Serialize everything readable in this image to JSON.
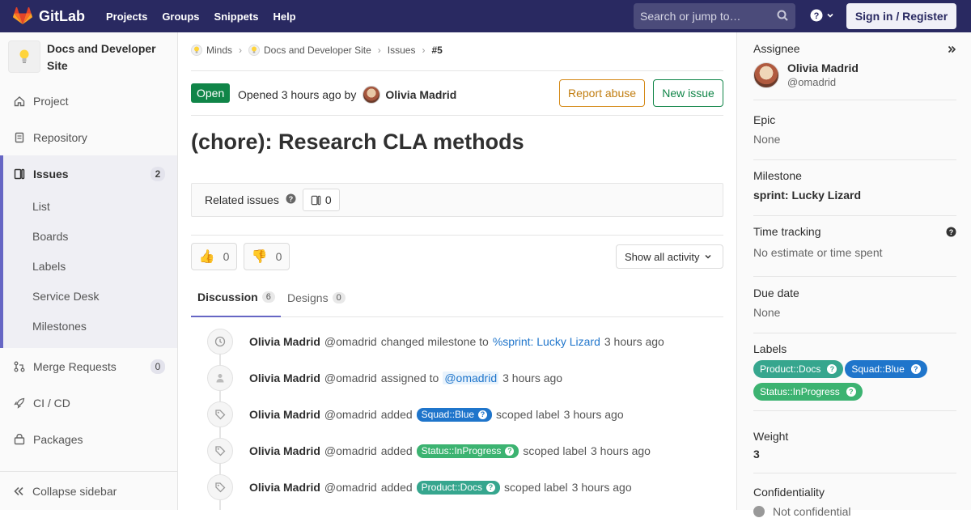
{
  "topnav": {
    "brand": "GitLab",
    "links": [
      "Projects",
      "Groups",
      "Snippets",
      "Help"
    ],
    "search_placeholder": "Search or jump to…",
    "signin": "Sign in / Register"
  },
  "sidebar": {
    "project_name": "Docs and Developer Site",
    "items": {
      "project": "Project",
      "repository": "Repository",
      "issues": "Issues",
      "issues_count": "2",
      "merge_requests": "Merge Requests",
      "mr_count": "0",
      "cicd": "CI / CD",
      "packages": "Packages"
    },
    "sub_items": [
      "List",
      "Boards",
      "Labels",
      "Service Desk",
      "Milestones"
    ],
    "collapse": "Collapse sidebar"
  },
  "breadcrumb": [
    "Minds",
    "Docs and Developer Site",
    "Issues",
    "#5"
  ],
  "issue": {
    "status": "Open",
    "opened_text": "Opened 3 hours ago by",
    "author": "Olivia Madrid",
    "report_abuse": "Report abuse",
    "new_issue": "New issue",
    "title": "(chore): Research CLA methods",
    "related_label": "Related issues",
    "related_count": "0",
    "thumbs_up": "0",
    "thumbs_down": "0",
    "activity_filter": "Show all activity"
  },
  "tabs": {
    "discussion": "Discussion",
    "discussion_count": "6",
    "designs": "Designs",
    "designs_count": "0"
  },
  "activity": [
    {
      "author": "Olivia Madrid",
      "handle": "@omadrid",
      "pre": "changed milestone to",
      "link": "%sprint: Lucky Lizard",
      "post": "",
      "ago": "3 hours ago",
      "icon": "clock-icon"
    },
    {
      "author": "Olivia Madrid",
      "handle": "@omadrid",
      "pre": "assigned to",
      "link": "@omadrid",
      "post": "",
      "ago": "3 hours ago",
      "icon": "user-icon"
    },
    {
      "author": "Olivia Madrid",
      "handle": "@omadrid",
      "pre": "added",
      "label": "Squad::Blue",
      "label_color": "#1f75cb",
      "post": "scoped label",
      "ago": "3 hours ago",
      "icon": "tag-icon"
    },
    {
      "author": "Olivia Madrid",
      "handle": "@omadrid",
      "pre": "added",
      "label": "Status::InProgress",
      "label_color": "#3cb371",
      "post": "scoped label",
      "ago": "3 hours ago",
      "icon": "tag-icon"
    },
    {
      "author": "Olivia Madrid",
      "handle": "@omadrid",
      "pre": "added",
      "label": "Product::Docs",
      "label_color": "#36a68e",
      "post": "scoped label",
      "ago": "3 hours ago",
      "icon": "tag-icon"
    }
  ],
  "right_sidebar": {
    "assignee_label": "Assignee",
    "assignee_name": "Olivia Madrid",
    "assignee_handle": "@omadrid",
    "epic_label": "Epic",
    "epic_value": "None",
    "milestone_label": "Milestone",
    "milestone_value": "sprint: Lucky Lizard",
    "time_label": "Time tracking",
    "time_value": "No estimate or time spent",
    "due_label": "Due date",
    "due_value": "None",
    "labels_label": "Labels",
    "labels": [
      {
        "text": "Product::Docs",
        "color": "#36a68e"
      },
      {
        "text": "Squad::Blue",
        "color": "#1f75cb"
      },
      {
        "text": "Status::InProgress",
        "color": "#3cb371"
      }
    ],
    "weight_label": "Weight",
    "weight_value": "3",
    "confidentiality_label": "Confidentiality",
    "confidentiality_value": "Not confidential"
  },
  "colors": {
    "nav_bg": "#292961",
    "accent": "#6666c4",
    "open_green": "#108548",
    "link_blue": "#1f75cb"
  }
}
